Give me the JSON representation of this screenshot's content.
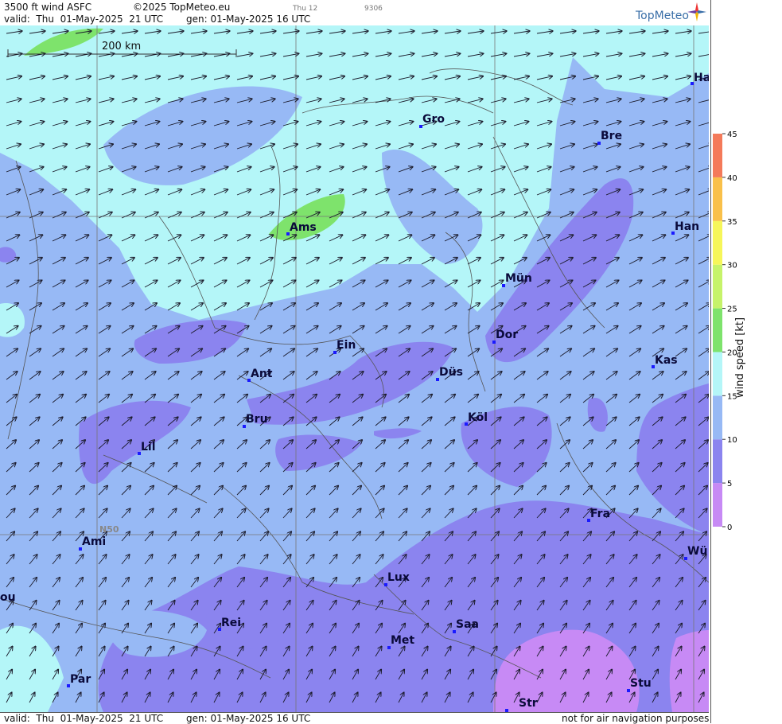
{
  "header": {
    "title": "3500 ft wind ASFC",
    "copyright": "©2025 TopMeteo.eu",
    "run_hint": "Thu 12",
    "code_hint": "9306",
    "valid": "valid:  Thu  01-May-2025  21 UTC",
    "generated": "gen: 01-May-2025 16 UTC",
    "brand": "TopMeteo"
  },
  "footer": {
    "valid": "valid:  Thu  01-May-2025  21 UTC",
    "generated": "gen: 01-May-2025 16 UTC",
    "disclaimer": "not for air navigation purposes"
  },
  "map": {
    "scale_label": "200 km",
    "lat_label": "N50",
    "cities": [
      {
        "name": "Gro"
      },
      {
        "name": "Bre"
      },
      {
        "name": "Ha"
      },
      {
        "name": "Ams"
      },
      {
        "name": "Han"
      },
      {
        "name": "Mün"
      },
      {
        "name": "Dor"
      },
      {
        "name": "Ein"
      },
      {
        "name": "Kas"
      },
      {
        "name": "Ant"
      },
      {
        "name": "Düs"
      },
      {
        "name": "Bru"
      },
      {
        "name": "Köl"
      },
      {
        "name": "Lil"
      },
      {
        "name": "Fra"
      },
      {
        "name": "Ami"
      },
      {
        "name": "Wü"
      },
      {
        "name": "ou"
      },
      {
        "name": "Lux"
      },
      {
        "name": "Saa"
      },
      {
        "name": "Rei"
      },
      {
        "name": "Met"
      },
      {
        "name": "Par"
      },
      {
        "name": "Stu"
      },
      {
        "name": "Str"
      }
    ],
    "wind_direction": "from west-southwest"
  },
  "legend": {
    "title": "wind speed [kt]",
    "ticks": [
      "45",
      "40",
      "35",
      "30",
      "25",
      "20",
      "15",
      "10",
      "5",
      "0"
    ],
    "colors": {
      "0-5": "#c78af5",
      "5-10": "#8b84ef",
      "10-15": "#97b9f5",
      "15-20": "#b4f6f8",
      "20-25": "#7ee36c",
      "25-30": "#c6f36a",
      "30-35": "#f6f65a",
      "35-40": "#f9c04a",
      "40-45": "#f47a5a"
    }
  }
}
